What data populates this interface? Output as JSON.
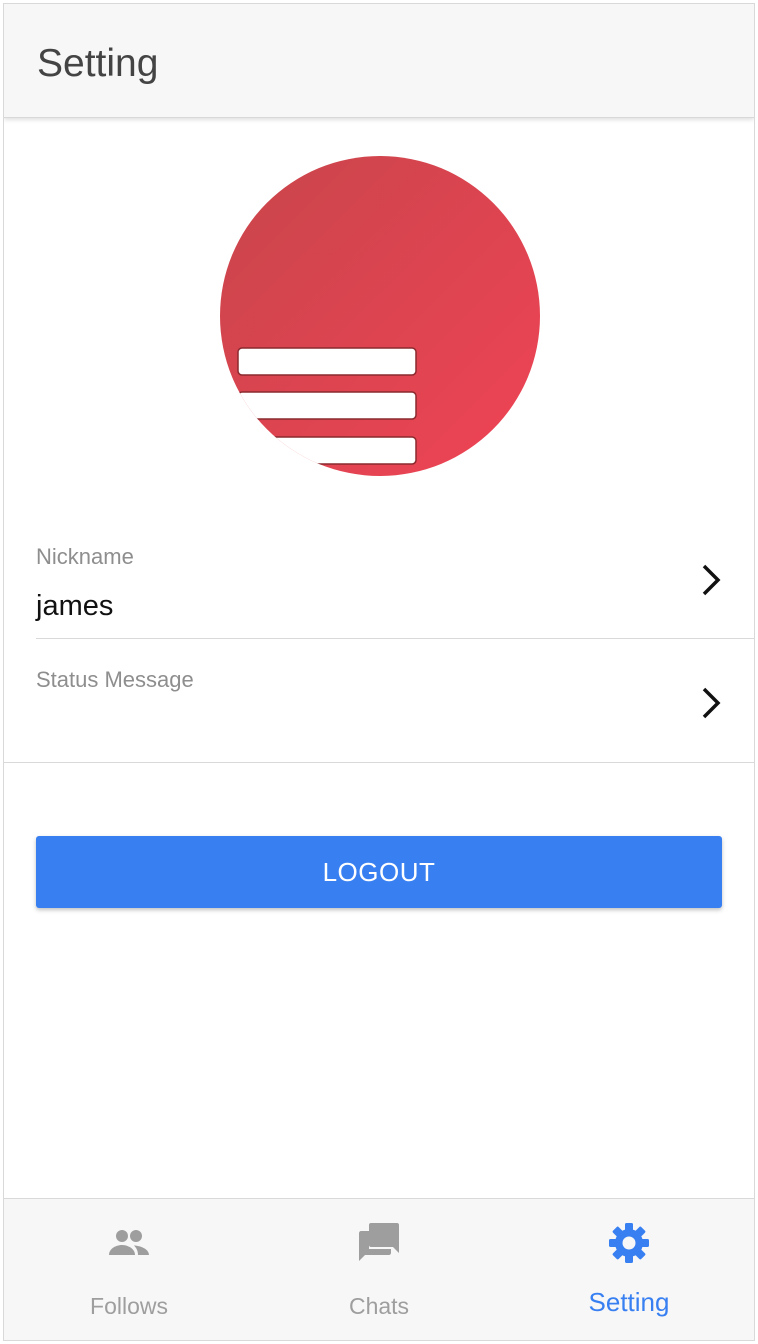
{
  "header": {
    "title": "Setting"
  },
  "profile": {
    "nickname_label": "Nickname",
    "nickname_value": "james",
    "status_label": "Status Message",
    "status_value": ""
  },
  "actions": {
    "logout_label": "LOGOUT"
  },
  "tabs": [
    {
      "label": "Follows",
      "icon": "people-icon",
      "active": false
    },
    {
      "label": "Chats",
      "icon": "chat-icon",
      "active": false
    },
    {
      "label": "Setting",
      "icon": "gear-icon",
      "active": true
    }
  ],
  "colors": {
    "accent": "#3880f2",
    "avatar": "#e0434f",
    "header_bg": "#f7f7f7"
  }
}
